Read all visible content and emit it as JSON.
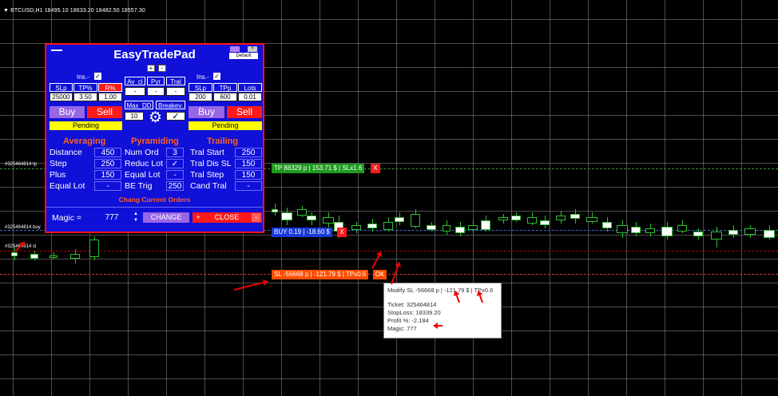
{
  "chart": {
    "header": "▼ BTCUSD,H1  18495.10 18633.20 18482.50 18557.30",
    "line_labels": {
      "tp": "#325464814 tp",
      "buy": "#325464814 buy",
      "sl": "#325464814 sl"
    },
    "tp_tag": "TP 88329 p | 153.71 $ | SLx1.6",
    "tp_close": "X",
    "buy_tag": "BUY 0.19 | -18.60 $",
    "buy_close": "X",
    "sl_tag": "SL -56668 p | -121.79 $ | TPx0.6",
    "sl_ok": "OK",
    "colors": {
      "tp": "#1e9a1e",
      "buy": "#1a3ad8",
      "sl": "#ff4d00",
      "close": "#ff1a1a"
    }
  },
  "tooltip": {
    "line1": "Modify SL -56668 p | -121.79 $ | TPx0.6",
    "ticket": "Ticket: 325464814",
    "stoploss": "StopLoss: 18339.20",
    "profit": "Profit %: -2.184",
    "magic": "Magic: 777"
  },
  "panel": {
    "title": "EasyTradePad",
    "minimize": "—",
    "default_label": "Default",
    "plus": "+",
    "minus": "-",
    "left": {
      "ins_label": "Ins.-",
      "headers": [
        "SLp",
        "TP%",
        "R%"
      ],
      "values": [
        "25000",
        "3.50",
        "1.00"
      ],
      "buy": "Buy",
      "sell": "Sell",
      "pending": "Pending"
    },
    "middle": {
      "headers": [
        "Av_cl",
        "Pyr",
        "Tral"
      ],
      "values": [
        "-",
        "-",
        "-"
      ],
      "max_dd_label": "Max_DD",
      "max_dd_value": "10",
      "breakeven_label": "Breakev.",
      "breakeven_check": "✓",
      "gear": "⚙"
    },
    "right": {
      "ins_label": "Ins.-",
      "headers": [
        "SLp",
        "TPp",
        "Lots"
      ],
      "values": [
        "200",
        "600",
        "0.01"
      ],
      "buy": "Buy",
      "sell": "Sell",
      "pending": "Pending"
    },
    "averaging": {
      "title": "Averaging",
      "rows": [
        {
          "label": "Distance",
          "value": "450"
        },
        {
          "label": "Step",
          "value": "250"
        },
        {
          "label": "Plus",
          "value": "150"
        },
        {
          "label": "Equal Lot",
          "value": "-"
        }
      ]
    },
    "pyramiding": {
      "title": "Pyramiding",
      "rows": [
        {
          "label": "Num Ord",
          "value": "3"
        },
        {
          "label": "Reduc Lot",
          "value": "✓"
        },
        {
          "label": "Equal Lot",
          "value": "-"
        },
        {
          "label": "BE Trig",
          "value": "250"
        }
      ]
    },
    "trailing": {
      "title": "Trailing",
      "rows": [
        {
          "label": "Tral Start",
          "value": "250"
        },
        {
          "label": "Tral Dis SL",
          "value": "150"
        },
        {
          "label": "Tral Step",
          "value": "150"
        },
        {
          "label": "Cand Tral",
          "value": "-"
        }
      ]
    },
    "change_orders": "Chang Current Orders",
    "magic_label": "Magic =",
    "magic_value": "777",
    "change_btn": "CHANGE",
    "close_btn": "CLOSE",
    "close_plus": "+",
    "close_minus": "-"
  }
}
